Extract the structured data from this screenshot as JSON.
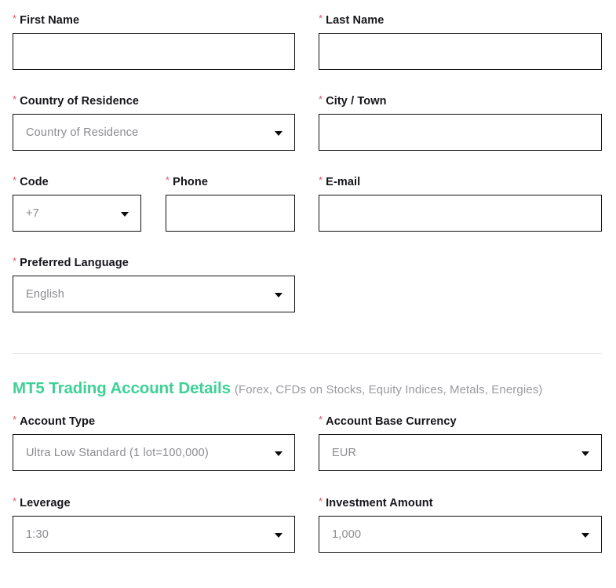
{
  "personal_section": {
    "rows": [
      {
        "fields": [
          {
            "label": "First Name",
            "required": true,
            "type": "text",
            "value": "",
            "column": "left"
          },
          {
            "label": "Last Name",
            "required": true,
            "type": "text",
            "value": "",
            "column": "right"
          }
        ]
      },
      {
        "fields": [
          {
            "label": "Country of Residence",
            "required": true,
            "type": "select",
            "value": "Country of Residence",
            "column": "left"
          },
          {
            "label": "City / Town",
            "required": true,
            "type": "text",
            "value": "",
            "column": "right"
          }
        ]
      },
      {
        "fields": [
          {
            "label": "Code",
            "required": true,
            "type": "select",
            "value": "+7",
            "column": "code"
          },
          {
            "label": "Phone",
            "required": true,
            "type": "text",
            "value": "",
            "column": "phone"
          },
          {
            "label": "E-mail",
            "required": true,
            "type": "text",
            "value": "",
            "column": "right"
          }
        ]
      },
      {
        "fields": [
          {
            "label": "Preferred Language",
            "required": true,
            "type": "select",
            "value": "English",
            "column": "left"
          }
        ]
      }
    ]
  },
  "trading_section": {
    "title": "MT5 Trading Account Details",
    "subtitle": "(Forex, CFDs on Stocks, Equity Indices, Metals, Energies)",
    "title_color": "#3ed195",
    "rows": [
      {
        "fields": [
          {
            "label": "Account Type",
            "required": true,
            "type": "select",
            "value": "Ultra Low Standard (1 lot=100,000)",
            "column": "left"
          },
          {
            "label": "Account Base Currency",
            "required": true,
            "type": "select",
            "value": "EUR",
            "column": "right"
          }
        ]
      },
      {
        "fields": [
          {
            "label": "Leverage",
            "required": true,
            "type": "select",
            "value": "1:30",
            "column": "left"
          },
          {
            "label": "Investment Amount",
            "required": true,
            "type": "select",
            "value": "1,000",
            "column": "right"
          }
        ]
      }
    ]
  },
  "icons": {
    "caret": "chevron-down-icon",
    "required_marker": "*"
  },
  "colors": {
    "required_asterisk": "#e8565e",
    "label": "#15141a",
    "placeholder": "#8b8b90",
    "border": "#111111",
    "divider": "#e3e3e5",
    "accent": "#3ed195",
    "subtitle": "#9a9aa0"
  },
  "layout": {
    "row_tops": [
      16,
      119,
      222,
      325
    ],
    "trading_row_tops": [
      527,
      631
    ]
  }
}
